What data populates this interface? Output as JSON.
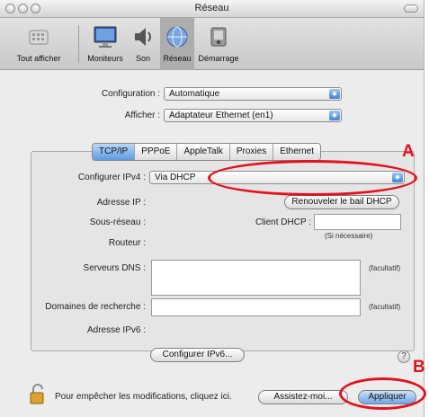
{
  "window": {
    "title": "Réseau"
  },
  "toolbar": {
    "items": [
      {
        "label": "Tout afficher",
        "icon": "show-all-icon"
      },
      {
        "label": "Moniteurs",
        "icon": "monitor-icon"
      },
      {
        "label": "Son",
        "icon": "speaker-icon"
      },
      {
        "label": "Réseau",
        "icon": "network-globe-icon",
        "selected": true
      },
      {
        "label": "Démarrage",
        "icon": "startup-disk-icon"
      }
    ]
  },
  "top": {
    "configuration_label": "Configuration :",
    "configuration_value": "Automatique",
    "afficher_label": "Afficher :",
    "afficher_value": "Adaptateur Ethernet (en1)"
  },
  "tabs": [
    {
      "label": "TCP/IP",
      "active": true
    },
    {
      "label": "PPPoE"
    },
    {
      "label": "AppleTalk"
    },
    {
      "label": "Proxies"
    },
    {
      "label": "Ethernet"
    }
  ],
  "tcpip": {
    "configurer_label": "Configurer IPv4 :",
    "configurer_value": "Via DHCP",
    "adresse_ip_label": "Adresse IP :",
    "renouveler_button": "Renouveler le bail DHCP",
    "sous_reseau_label": "Sous-réseau :",
    "client_dhcp_label": "Client DHCP :",
    "client_dhcp_value": "",
    "si_necessaire": "(Si nécessaire)",
    "routeur_label": "Routeur :",
    "serveurs_dns_label": "Serveurs DNS :",
    "facultatif_1": "(facultatif)",
    "domaines_label": "Domaines de recherche :",
    "facultatif_2": "(facultatif)",
    "ipv6_label": "Adresse IPv6 :",
    "configurer_ipv6_button": "Configurer IPv6...",
    "help": "?"
  },
  "footer": {
    "lock_text": "Pour empêcher les modifications, cliquez ici.",
    "assistez_button": "Assistez-moi...",
    "appliquer_button": "Appliquer"
  },
  "annotations": {
    "a": "A",
    "b": "B",
    "color": "#e3121d"
  },
  "colors": {
    "selection_blue": "#5d9be0",
    "annotation_red": "#e3121d"
  }
}
